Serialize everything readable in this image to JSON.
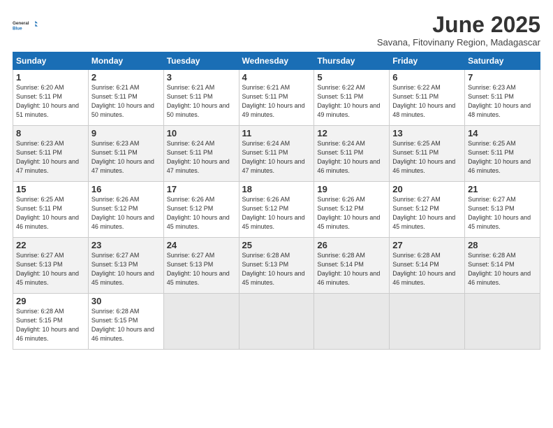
{
  "header": {
    "logo_general": "General",
    "logo_blue": "Blue",
    "title": "June 2025",
    "subtitle": "Savana, Fitovinany Region, Madagascar"
  },
  "days_of_week": [
    "Sunday",
    "Monday",
    "Tuesday",
    "Wednesday",
    "Thursday",
    "Friday",
    "Saturday"
  ],
  "weeks": [
    [
      {
        "num": "1",
        "sunrise": "Sunrise: 6:20 AM",
        "sunset": "Sunset: 5:11 PM",
        "daylight": "Daylight: 10 hours and 51 minutes."
      },
      {
        "num": "2",
        "sunrise": "Sunrise: 6:21 AM",
        "sunset": "Sunset: 5:11 PM",
        "daylight": "Daylight: 10 hours and 50 minutes."
      },
      {
        "num": "3",
        "sunrise": "Sunrise: 6:21 AM",
        "sunset": "Sunset: 5:11 PM",
        "daylight": "Daylight: 10 hours and 50 minutes."
      },
      {
        "num": "4",
        "sunrise": "Sunrise: 6:21 AM",
        "sunset": "Sunset: 5:11 PM",
        "daylight": "Daylight: 10 hours and 49 minutes."
      },
      {
        "num": "5",
        "sunrise": "Sunrise: 6:22 AM",
        "sunset": "Sunset: 5:11 PM",
        "daylight": "Daylight: 10 hours and 49 minutes."
      },
      {
        "num": "6",
        "sunrise": "Sunrise: 6:22 AM",
        "sunset": "Sunset: 5:11 PM",
        "daylight": "Daylight: 10 hours and 48 minutes."
      },
      {
        "num": "7",
        "sunrise": "Sunrise: 6:23 AM",
        "sunset": "Sunset: 5:11 PM",
        "daylight": "Daylight: 10 hours and 48 minutes."
      }
    ],
    [
      {
        "num": "8",
        "sunrise": "Sunrise: 6:23 AM",
        "sunset": "Sunset: 5:11 PM",
        "daylight": "Daylight: 10 hours and 47 minutes."
      },
      {
        "num": "9",
        "sunrise": "Sunrise: 6:23 AM",
        "sunset": "Sunset: 5:11 PM",
        "daylight": "Daylight: 10 hours and 47 minutes."
      },
      {
        "num": "10",
        "sunrise": "Sunrise: 6:24 AM",
        "sunset": "Sunset: 5:11 PM",
        "daylight": "Daylight: 10 hours and 47 minutes."
      },
      {
        "num": "11",
        "sunrise": "Sunrise: 6:24 AM",
        "sunset": "Sunset: 5:11 PM",
        "daylight": "Daylight: 10 hours and 47 minutes."
      },
      {
        "num": "12",
        "sunrise": "Sunrise: 6:24 AM",
        "sunset": "Sunset: 5:11 PM",
        "daylight": "Daylight: 10 hours and 46 minutes."
      },
      {
        "num": "13",
        "sunrise": "Sunrise: 6:25 AM",
        "sunset": "Sunset: 5:11 PM",
        "daylight": "Daylight: 10 hours and 46 minutes."
      },
      {
        "num": "14",
        "sunrise": "Sunrise: 6:25 AM",
        "sunset": "Sunset: 5:11 PM",
        "daylight": "Daylight: 10 hours and 46 minutes."
      }
    ],
    [
      {
        "num": "15",
        "sunrise": "Sunrise: 6:25 AM",
        "sunset": "Sunset: 5:11 PM",
        "daylight": "Daylight: 10 hours and 46 minutes."
      },
      {
        "num": "16",
        "sunrise": "Sunrise: 6:26 AM",
        "sunset": "Sunset: 5:12 PM",
        "daylight": "Daylight: 10 hours and 46 minutes."
      },
      {
        "num": "17",
        "sunrise": "Sunrise: 6:26 AM",
        "sunset": "Sunset: 5:12 PM",
        "daylight": "Daylight: 10 hours and 45 minutes."
      },
      {
        "num": "18",
        "sunrise": "Sunrise: 6:26 AM",
        "sunset": "Sunset: 5:12 PM",
        "daylight": "Daylight: 10 hours and 45 minutes."
      },
      {
        "num": "19",
        "sunrise": "Sunrise: 6:26 AM",
        "sunset": "Sunset: 5:12 PM",
        "daylight": "Daylight: 10 hours and 45 minutes."
      },
      {
        "num": "20",
        "sunrise": "Sunrise: 6:27 AM",
        "sunset": "Sunset: 5:12 PM",
        "daylight": "Daylight: 10 hours and 45 minutes."
      },
      {
        "num": "21",
        "sunrise": "Sunrise: 6:27 AM",
        "sunset": "Sunset: 5:13 PM",
        "daylight": "Daylight: 10 hours and 45 minutes."
      }
    ],
    [
      {
        "num": "22",
        "sunrise": "Sunrise: 6:27 AM",
        "sunset": "Sunset: 5:13 PM",
        "daylight": "Daylight: 10 hours and 45 minutes."
      },
      {
        "num": "23",
        "sunrise": "Sunrise: 6:27 AM",
        "sunset": "Sunset: 5:13 PM",
        "daylight": "Daylight: 10 hours and 45 minutes."
      },
      {
        "num": "24",
        "sunrise": "Sunrise: 6:27 AM",
        "sunset": "Sunset: 5:13 PM",
        "daylight": "Daylight: 10 hours and 45 minutes."
      },
      {
        "num": "25",
        "sunrise": "Sunrise: 6:28 AM",
        "sunset": "Sunset: 5:13 PM",
        "daylight": "Daylight: 10 hours and 45 minutes."
      },
      {
        "num": "26",
        "sunrise": "Sunrise: 6:28 AM",
        "sunset": "Sunset: 5:14 PM",
        "daylight": "Daylight: 10 hours and 46 minutes."
      },
      {
        "num": "27",
        "sunrise": "Sunrise: 6:28 AM",
        "sunset": "Sunset: 5:14 PM",
        "daylight": "Daylight: 10 hours and 46 minutes."
      },
      {
        "num": "28",
        "sunrise": "Sunrise: 6:28 AM",
        "sunset": "Sunset: 5:14 PM",
        "daylight": "Daylight: 10 hours and 46 minutes."
      }
    ],
    [
      {
        "num": "29",
        "sunrise": "Sunrise: 6:28 AM",
        "sunset": "Sunset: 5:15 PM",
        "daylight": "Daylight: 10 hours and 46 minutes."
      },
      {
        "num": "30",
        "sunrise": "Sunrise: 6:28 AM",
        "sunset": "Sunset: 5:15 PM",
        "daylight": "Daylight: 10 hours and 46 minutes."
      },
      null,
      null,
      null,
      null,
      null
    ]
  ]
}
